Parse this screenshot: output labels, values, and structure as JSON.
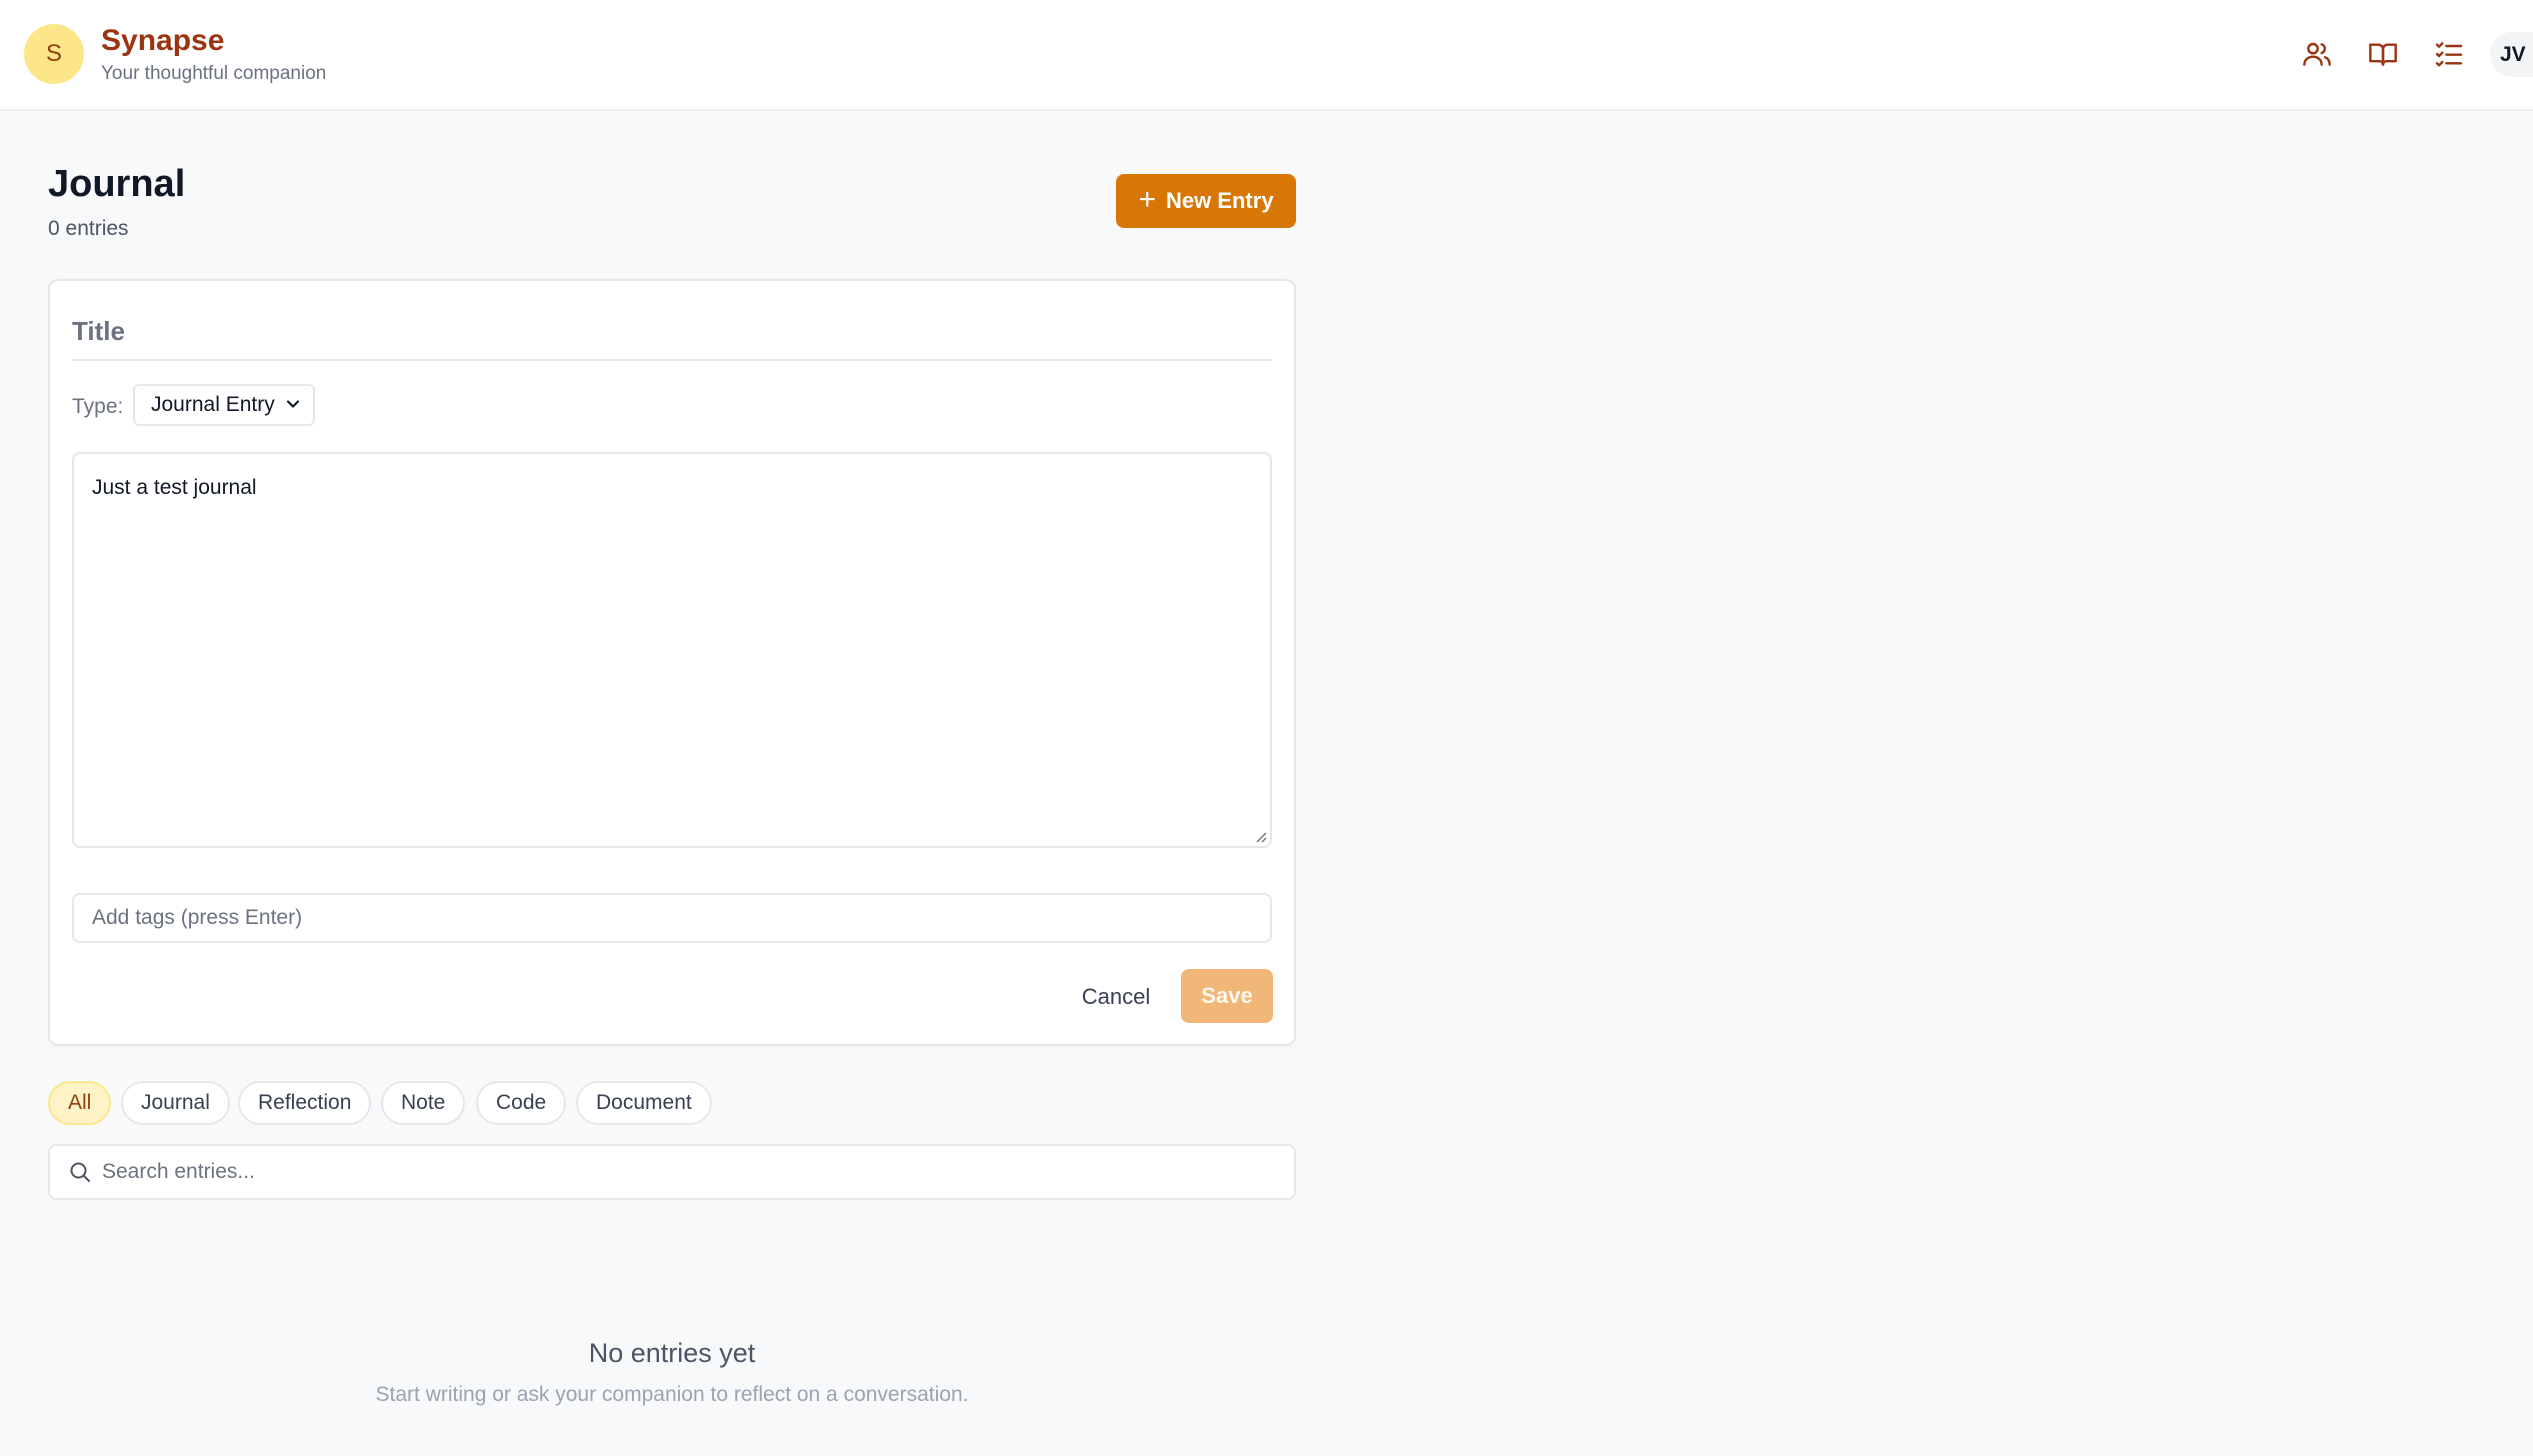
{
  "header": {
    "logo_letter": "S",
    "brand_name": "Synapse",
    "tagline": "Your thoughtful companion",
    "icons": [
      "people-icon",
      "book-icon",
      "list-icon"
    ],
    "user_initials": "JV"
  },
  "journal": {
    "title": "Journal",
    "entries_count": "0 entries",
    "new_entry_label": "New Entry"
  },
  "editor": {
    "title_placeholder": "Title",
    "type_label": "Type:",
    "type_value": "Journal Entry",
    "body_text": "Just a test journal",
    "tags_placeholder": "Add tags (press Enter)",
    "cancel_label": "Cancel",
    "save_label": "Save"
  },
  "filters": {
    "chips": [
      "All",
      "Journal",
      "Reflection",
      "Note",
      "Code",
      "Document"
    ],
    "active": "All"
  },
  "search": {
    "placeholder": "Search entries..."
  },
  "empty_state": {
    "title": "No entries yet",
    "subtitle": "Start writing or ask your companion to reflect on a conversation."
  },
  "colors": {
    "brand": "#9a3412",
    "accent": "#d97706",
    "save_disabled": "#f0b778",
    "active_chip": "#fef3c7"
  }
}
